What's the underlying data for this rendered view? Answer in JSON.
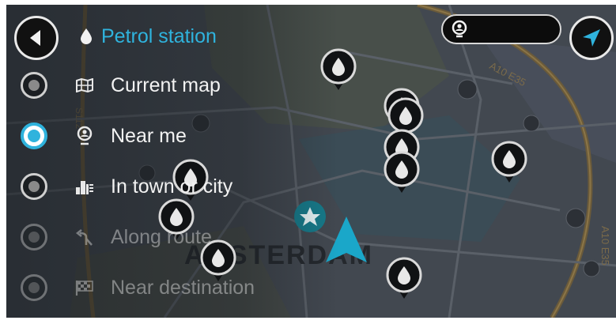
{
  "header": {
    "back_icon": "back-arrow-icon",
    "category_icon": "fuel-drop-icon",
    "title": "Petrol station",
    "search_location_icon": "location-pin-icon",
    "nav_icon": "navigation-arrow-icon",
    "accent_color": "#2fb3dd"
  },
  "options": [
    {
      "label": "Current map",
      "icon": "map-icon",
      "selected": false,
      "enabled": true
    },
    {
      "label": "Near me",
      "icon": "location-pin-icon",
      "selected": true,
      "enabled": true
    },
    {
      "label": "In town or city",
      "icon": "city-buildings-icon",
      "selected": false,
      "enabled": true
    },
    {
      "label": "Along route",
      "icon": "route-turn-icon",
      "selected": false,
      "enabled": false
    },
    {
      "label": "Near destination",
      "icon": "checkered-flag-icon",
      "selected": false,
      "enabled": false
    }
  ],
  "map": {
    "city_label": "AMSTERDAM",
    "road_labels": [
      "A10 E35",
      "A10 E35",
      "S112"
    ]
  }
}
